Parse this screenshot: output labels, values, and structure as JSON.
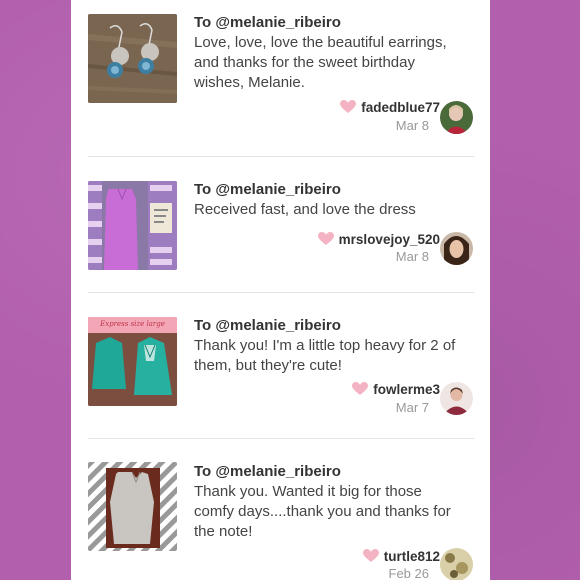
{
  "colors": {
    "background": "#b25fae",
    "heart": "#f4b3c2",
    "text": "#333333",
    "muted": "#999999"
  },
  "reviews": [
    {
      "to": "To @melanie_ribeiro",
      "message_lines": [
        "Love, love, love the beautiful earrings,",
        "and thanks for the sweet birthday",
        "wishes, Melanie."
      ],
      "username": "fadedblue77",
      "date": "Mar 8",
      "thumb_icon": "earrings-photo"
    },
    {
      "to": "To @melanie_ribeiro",
      "message_lines": [
        "Received fast, and love the dress"
      ],
      "username": "mrslovejoy_520",
      "date": "Mar 8",
      "thumb_icon": "dress-photo"
    },
    {
      "to": "To @melanie_ribeiro",
      "message_lines": [
        "Thank you! I'm a little top heavy for 2 of",
        "them, but they're cute!"
      ],
      "username": "fowlerme3",
      "date": "Mar 7",
      "thumb_icon": "tops-photo",
      "thumb_caption": "Express size large"
    },
    {
      "to": "To @melanie_ribeiro",
      "message_lines": [
        "Thank you. Wanted it big for those",
        "comfy days....thank you and thanks for",
        "the note!"
      ],
      "username": "turtle812",
      "date": "Feb 26",
      "thumb_icon": "sweater-photo"
    }
  ]
}
